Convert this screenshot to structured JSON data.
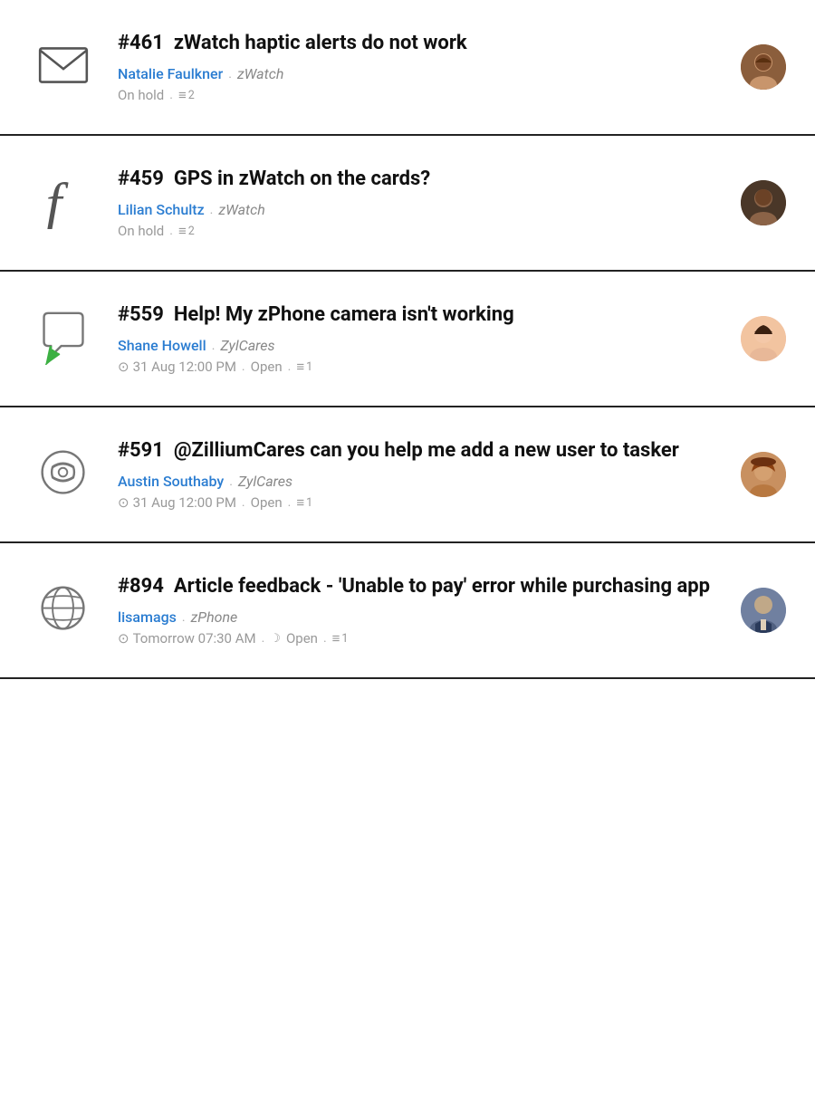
{
  "tickets": [
    {
      "id": "ticket-461",
      "number": "#461",
      "title": "zWatch haptic alerts do not work",
      "requester": "Natalie Faulkner",
      "product": "zWatch",
      "status": "On hold",
      "replies": "2",
      "time": null,
      "icon_type": "envelope",
      "avatar_class": "avatar-female-dark"
    },
    {
      "id": "ticket-459",
      "number": "#459",
      "title": "GPS in zWatch on the cards?",
      "requester": "Lilian Schultz",
      "product": "zWatch",
      "status": "On hold",
      "replies": "2",
      "time": null,
      "icon_type": "facebook",
      "avatar_class": "avatar-male-dark"
    },
    {
      "id": "ticket-559",
      "number": "#559",
      "title": "Help! My zPhone camera isn't working",
      "requester": "Shane Howell",
      "product": "ZylCares",
      "status": "Open",
      "replies": "1",
      "time": "31 Aug 12:00 PM",
      "icon_type": "chat",
      "avatar_class": "avatar-female-asian"
    },
    {
      "id": "ticket-591",
      "number": "#591",
      "title": "@ZilliumCares can you help me add a new user to tasker",
      "requester": "Austin Southaby",
      "product": "ZylCares",
      "status": "Open",
      "replies": "1",
      "time": "31 Aug 12:00 PM",
      "icon_type": "phone",
      "avatar_class": "avatar-female-hat"
    },
    {
      "id": "ticket-894",
      "number": "#894",
      "title": "Article feedback - 'Unable to pay' error while purchasing app",
      "requester": "lisamags",
      "product": "zPhone",
      "status": "Open",
      "replies": "1",
      "time": "Tomorrow 07:30 AM",
      "icon_type": "globe",
      "avatar_class": "avatar-male-suit",
      "time_icon": "snoozed"
    }
  ],
  "labels": {
    "on_hold": "On hold",
    "open": "Open",
    "dot": ".",
    "replies_icon": "≡"
  }
}
